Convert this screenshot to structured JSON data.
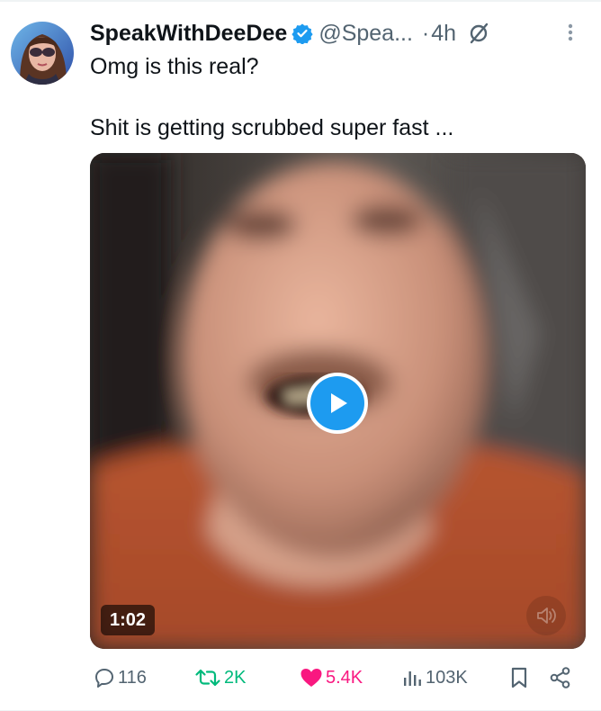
{
  "tweet": {
    "display_name": "SpeakWithDeeDee",
    "handle": "@Spea...",
    "dot": "·",
    "time": "4h",
    "text_line_1": "Omg is this real?",
    "text_line_2": "Shit is getting scrubbed super fast ...",
    "verified": true
  },
  "media": {
    "type": "video",
    "duration": "1:02",
    "muted": true
  },
  "actions": {
    "replies": "116",
    "reposts": "2K",
    "likes": "5.4K",
    "views": "103K"
  },
  "colors": {
    "brand_blue": "#1d9bf0",
    "repost_green": "#00ba7c",
    "like_pink": "#f91880",
    "secondary_text": "#536471",
    "primary_text": "#0f1419"
  },
  "icons": {
    "verified": "verified-badge-icon",
    "grok": "grok-icon",
    "more": "more-vertical-icon",
    "reply": "reply-icon",
    "repost": "repost-icon",
    "like": "heart-filled-icon",
    "views": "views-chart-icon",
    "bookmark": "bookmark-icon",
    "share": "share-icon",
    "play": "play-icon",
    "volume": "volume-muted-icon"
  }
}
